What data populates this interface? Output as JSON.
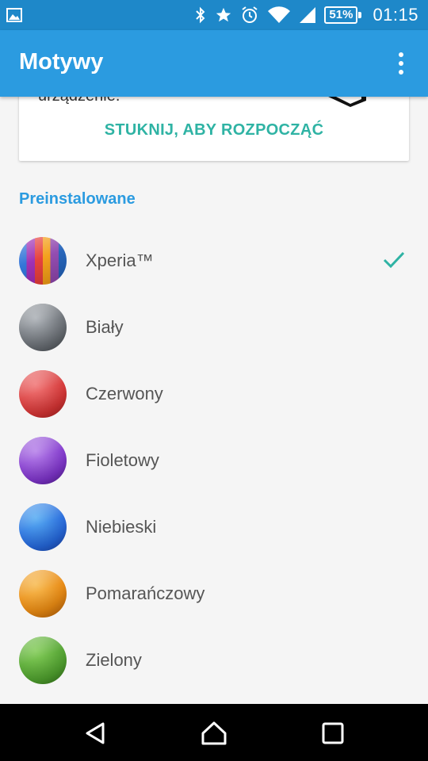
{
  "status_bar": {
    "battery": "51%",
    "time": "01:15",
    "icons": [
      "image-icon",
      "bluetooth-icon",
      "star-icon",
      "alarm-icon",
      "wifi-icon",
      "signal-icon",
      "battery-icon"
    ]
  },
  "app_bar": {
    "title": "Motywy",
    "menu_icon": "overflow-menu-icon"
  },
  "card": {
    "description_partial": "urządzenie.",
    "action_label": "STUKNIJ, ABY ROZPOCZĄĆ"
  },
  "section": {
    "header": "Preinstalowane"
  },
  "themes": [
    {
      "label": "Xperia™",
      "selected": true,
      "color": "#8e44ad"
    },
    {
      "label": "Biały",
      "selected": false,
      "color": "#7a7f85"
    },
    {
      "label": "Czerwony",
      "selected": false,
      "color": "#d83a3a"
    },
    {
      "label": "Fioletowy",
      "selected": false,
      "color": "#7b2fc9"
    },
    {
      "label": "Niebieski",
      "selected": false,
      "color": "#1f63d9"
    },
    {
      "label": "Pomarańczowy",
      "selected": false,
      "color": "#e8870c"
    },
    {
      "label": "Zielony",
      "selected": false,
      "color": "#4a9d28"
    }
  ],
  "colors": {
    "status_bar": "#1e88c9",
    "app_bar": "#2b9be0",
    "accent_teal": "#2fb3a4",
    "section_blue": "#2b9be0"
  },
  "nav_bar": {
    "icons": [
      "back-icon",
      "home-icon",
      "recents-icon"
    ]
  }
}
